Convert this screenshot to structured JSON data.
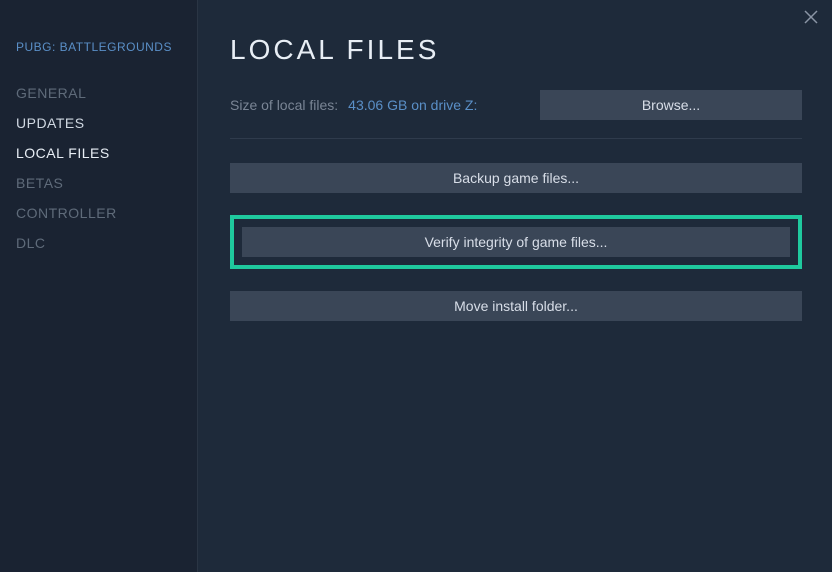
{
  "game_title": "PUBG: BATTLEGROUNDS",
  "sidebar": {
    "items": [
      {
        "label": "GENERAL"
      },
      {
        "label": "UPDATES"
      },
      {
        "label": "LOCAL FILES"
      },
      {
        "label": "BETAS"
      },
      {
        "label": "CONTROLLER"
      },
      {
        "label": "DLC"
      }
    ]
  },
  "main": {
    "title": "LOCAL FILES",
    "size_label": "Size of local files:",
    "size_value": "43.06 GB on drive Z:",
    "browse_label": "Browse...",
    "backup_label": "Backup game files...",
    "verify_label": "Verify integrity of game files...",
    "move_label": "Move install folder..."
  }
}
